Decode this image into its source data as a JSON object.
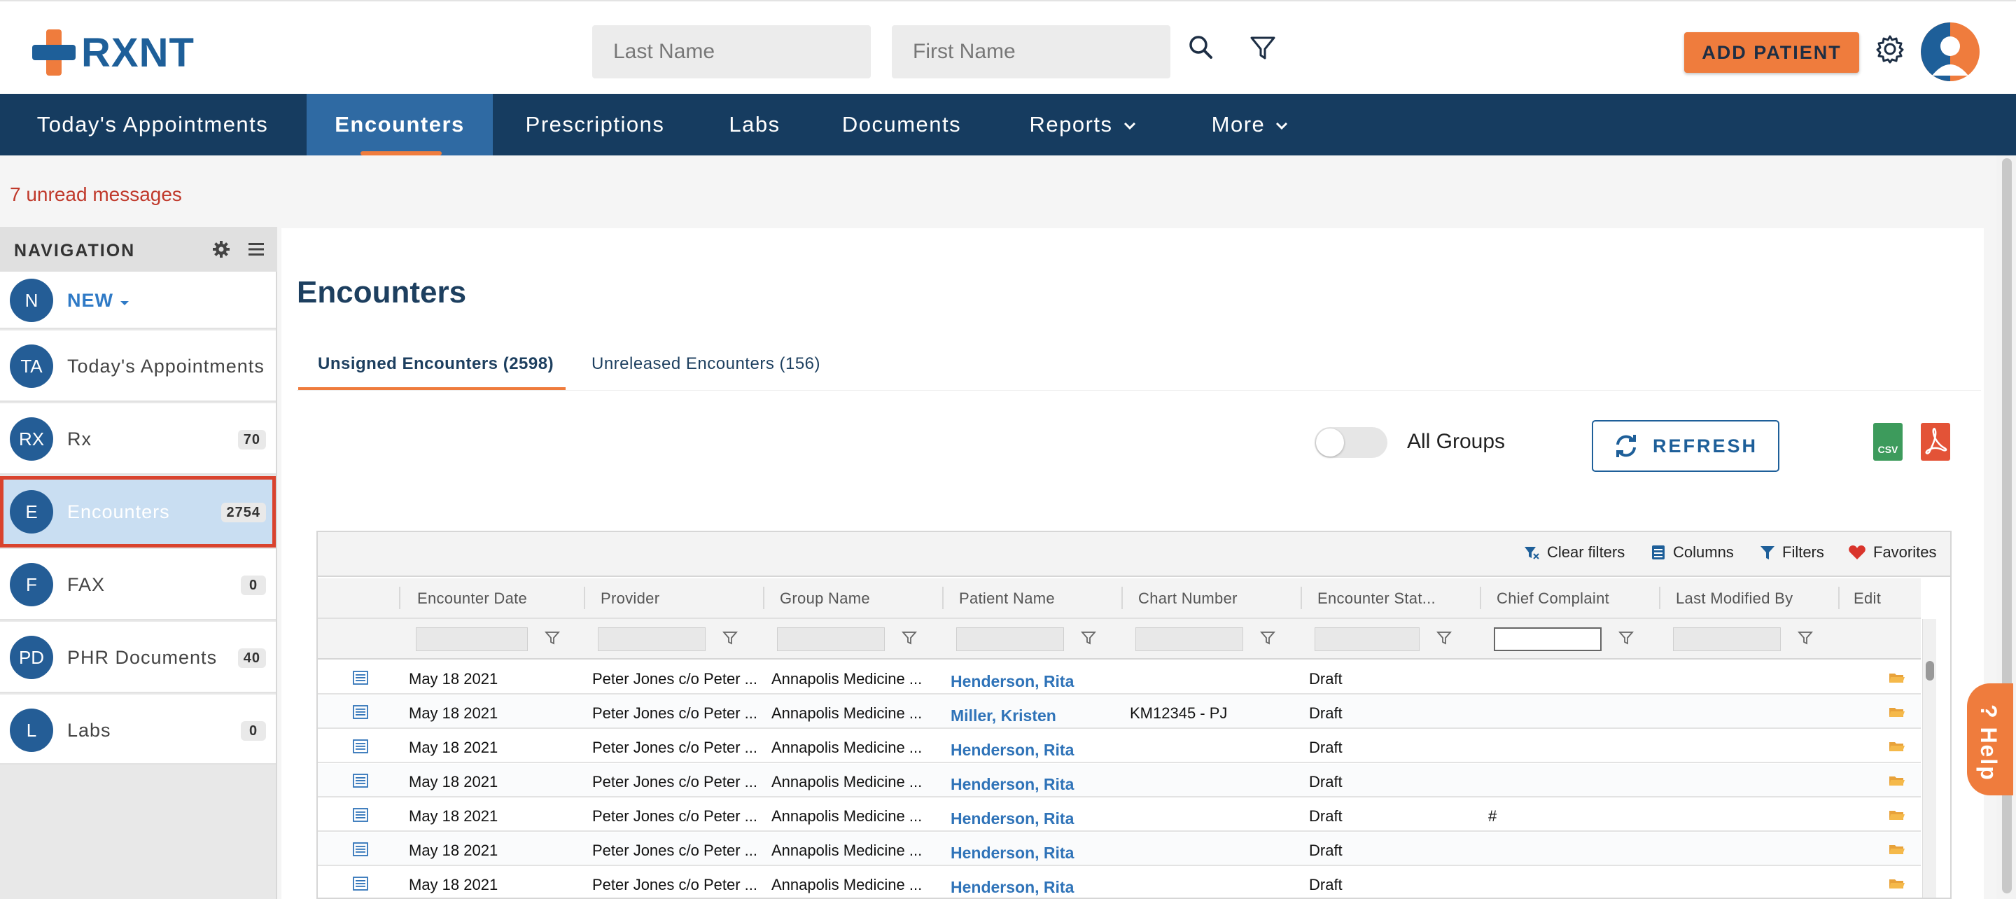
{
  "header": {
    "logo_text": "RXNT",
    "last_name_placeholder": "Last Name",
    "first_name_placeholder": "First Name",
    "add_patient": "ADD PATIENT"
  },
  "nav": {
    "items": [
      {
        "label": "Today's Appointments"
      },
      {
        "label": "Encounters"
      },
      {
        "label": "Prescriptions"
      },
      {
        "label": "Labs"
      },
      {
        "label": "Documents"
      },
      {
        "label": "Reports"
      },
      {
        "label": "More"
      }
    ]
  },
  "unread": "7 unread messages",
  "sidebar": {
    "title": "NAVIGATION",
    "items": [
      {
        "abbr": "N",
        "label": "NEW",
        "badge": ""
      },
      {
        "abbr": "TA",
        "label": "Today's Appointments",
        "badge": ""
      },
      {
        "abbr": "RX",
        "label": "Rx",
        "badge": "70"
      },
      {
        "abbr": "E",
        "label": "Encounters",
        "badge": "2754"
      },
      {
        "abbr": "F",
        "label": "FAX",
        "badge": "0"
      },
      {
        "abbr": "PD",
        "label": "PHR Documents",
        "badge": "40"
      },
      {
        "abbr": "L",
        "label": "Labs",
        "badge": "0"
      }
    ]
  },
  "main": {
    "title": "Encounters",
    "tabs": [
      {
        "label": "Unsigned Encounters (2598)"
      },
      {
        "label": "Unreleased Encounters (156)"
      }
    ],
    "toggle_label": "All Groups",
    "refresh": "REFRESH",
    "csv_label": "CSV"
  },
  "grid": {
    "toolbar": {
      "clear_filters": "Clear filters",
      "columns": "Columns",
      "filters": "Filters",
      "favorites": "Favorites"
    },
    "columns": [
      "Encounter Date",
      "Provider",
      "Group Name",
      "Patient Name",
      "Chart Number",
      "Encounter Stat...",
      "Chief Complaint",
      "Last Modified By",
      "Edit"
    ],
    "rows": [
      {
        "date": "May 18 2021",
        "provider": "Peter Jones c/o Peter ...",
        "group": "Annapolis Medicine ...",
        "patient": "Henderson, Rita",
        "chart": "",
        "status": "Draft",
        "complaint": ""
      },
      {
        "date": "May 18 2021",
        "provider": "Peter Jones c/o Peter ...",
        "group": "Annapolis Medicine ...",
        "patient": "Miller, Kristen",
        "chart": "KM12345 - PJ",
        "status": "Draft",
        "complaint": ""
      },
      {
        "date": "May 18 2021",
        "provider": "Peter Jones c/o Peter ...",
        "group": "Annapolis Medicine ...",
        "patient": "Henderson, Rita",
        "chart": "",
        "status": "Draft",
        "complaint": ""
      },
      {
        "date": "May 18 2021",
        "provider": "Peter Jones c/o Peter ...",
        "group": "Annapolis Medicine ...",
        "patient": "Henderson, Rita",
        "chart": "",
        "status": "Draft",
        "complaint": ""
      },
      {
        "date": "May 18 2021",
        "provider": "Peter Jones c/o Peter ...",
        "group": "Annapolis Medicine ...",
        "patient": "Henderson, Rita",
        "chart": "",
        "status": "Draft",
        "complaint": "#"
      },
      {
        "date": "May 18 2021",
        "provider": "Peter Jones c/o Peter ...",
        "group": "Annapolis Medicine ...",
        "patient": "Henderson, Rita",
        "chart": "",
        "status": "Draft",
        "complaint": ""
      },
      {
        "date": "May 18 2021",
        "provider": "Peter Jones c/o Peter ...",
        "group": "Annapolis Medicine ...",
        "patient": "Henderson, Rita",
        "chart": "",
        "status": "Draft",
        "complaint": ""
      }
    ]
  },
  "help_label": "? Help",
  "colors": {
    "brand_blue": "#1e5f99",
    "accent_orange": "#ef7c3d",
    "nav_bg": "#163c60",
    "alert_red": "#c0392b"
  },
  "icons": [
    "search-icon",
    "filter-icon",
    "gear-icon",
    "user-avatar-icon",
    "chevron-down-icon",
    "hamburger-icon",
    "refresh-icon",
    "csv-file-icon",
    "pdf-file-icon",
    "clear-filter-icon",
    "columns-icon",
    "heart-icon",
    "row-detail-icon",
    "folder-icon"
  ]
}
